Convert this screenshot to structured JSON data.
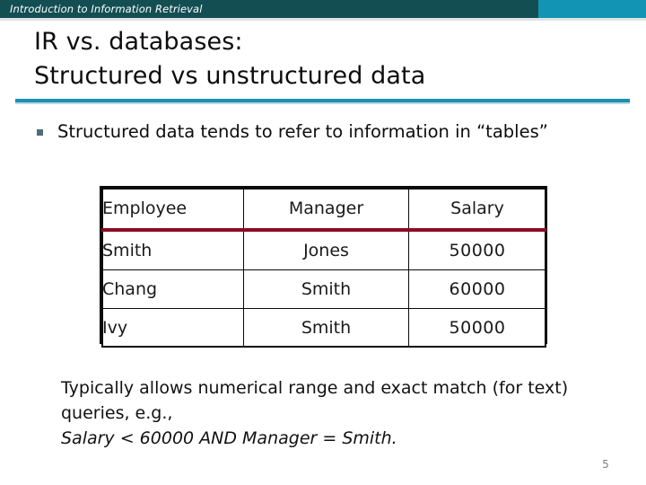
{
  "banner": {
    "title": "Introduction to Information Retrieval",
    "dark_color": "#134e53",
    "light_color": "#1295b4"
  },
  "slide": {
    "title_line1": "IR vs. databases:",
    "title_line2": "Structured vs unstructured data",
    "rule_color": "#1f8fb2",
    "page_number": "5"
  },
  "bullet": {
    "marker": "square-bullet",
    "marker_color": "#4f6d7a",
    "text": "Structured data tends to refer to information in “tables”"
  },
  "table": {
    "header_rule_color": "#8c0b22",
    "headers": [
      "Employee",
      "Manager",
      "Salary"
    ],
    "rows": [
      [
        "Smith",
        "Jones",
        "50000"
      ],
      [
        "Chang",
        "Smith",
        "60000"
      ],
      [
        "Ivy",
        "Smith",
        "50000"
      ]
    ]
  },
  "closing": {
    "line1": "Typically allows numerical range and exact match",
    "line2": "(for text) queries, e.g.,",
    "line3_italic": "Salary < 60000 AND Manager = Smith."
  }
}
